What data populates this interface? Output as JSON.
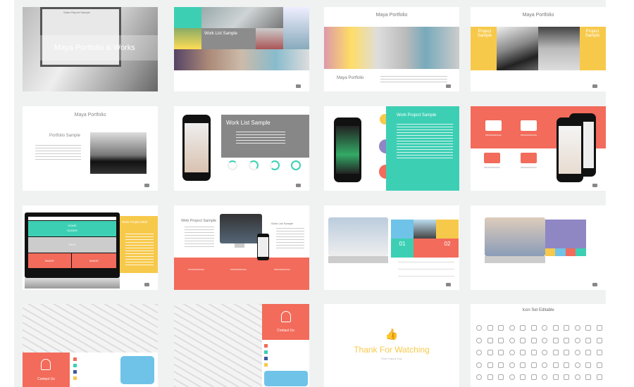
{
  "colors": {
    "teal": "#3dcfb4",
    "yellow": "#f7c94b",
    "coral": "#f26b5b",
    "purple": "#8e87c4",
    "blue": "#6fc3e8",
    "gray": "#8a8a8a",
    "background": "#f0f2f2"
  },
  "slides": {
    "s1": {
      "title": "Maya Portfolio & Works",
      "screen_title": "Sales Report Sample"
    },
    "s2": {
      "title": "Work List Sample"
    },
    "s3": {
      "title": "Maya Portfolio",
      "footer_title": "Maya Portfolio"
    },
    "s4": {
      "title": "Maya Portfolio",
      "left_label": "Project Sample",
      "right_label": "Project Sample"
    },
    "s5": {
      "title": "Maya Portfolio",
      "subtitle": "Portfolio Sample"
    },
    "s6": {
      "title": "Work List Sample"
    },
    "s7": {
      "title": "Work Project Sample"
    },
    "s8": {
      "labels": [
        "PROFESSIONAL",
        "PROFESSIONAL",
        "PROFESSIONAL",
        "PROFESSIONAL"
      ]
    },
    "s9": {
      "title": "Work Project Web",
      "home": "HOME",
      "slider": "SLIDER",
      "text": "TEXT",
      "image1": "IMAGE",
      "image2": "IMAGE"
    },
    "s10": {
      "title": "Web Project Sample",
      "side_title": "Work List Sample",
      "labels": [
        "PROFESSIONAL",
        "PROFESSIONAL",
        "PROFESSIONAL"
      ]
    },
    "s11": {
      "num1": "01",
      "num2": "02"
    },
    "s12": {},
    "s13": {
      "contact": "Contact Us"
    },
    "s14": {
      "contact": "Contact Us"
    },
    "s15": {
      "title": "Thank For Watching",
      "subtitle": "Wish Happy Day"
    },
    "s16": {
      "title": "Icon Set Editable",
      "icons": [
        "cloud",
        "heart",
        "monitor",
        "star",
        "scissors",
        "video",
        "document",
        "card",
        "thumb-up",
        "note",
        "save",
        "watch",
        "trash",
        "user",
        "key",
        "search",
        "gear",
        "camera",
        "send",
        "grid",
        "tag",
        "database",
        "music",
        "megaphone",
        "tablet",
        "diamond",
        "lock",
        "bulb",
        "pencil",
        "display",
        "chat",
        "brush",
        "coffee",
        "shirt",
        "cursor",
        "pen",
        "pin",
        "eye",
        "speech",
        "mail",
        "cup",
        "phone",
        "print",
        "calendar",
        "window",
        "clock",
        "truck",
        "globe",
        "chart",
        "pin2",
        "person",
        "lifebuoy",
        "map",
        "plane",
        "chat2",
        "check",
        "speech2",
        "wifi",
        "broadcast",
        "bag"
      ]
    }
  }
}
